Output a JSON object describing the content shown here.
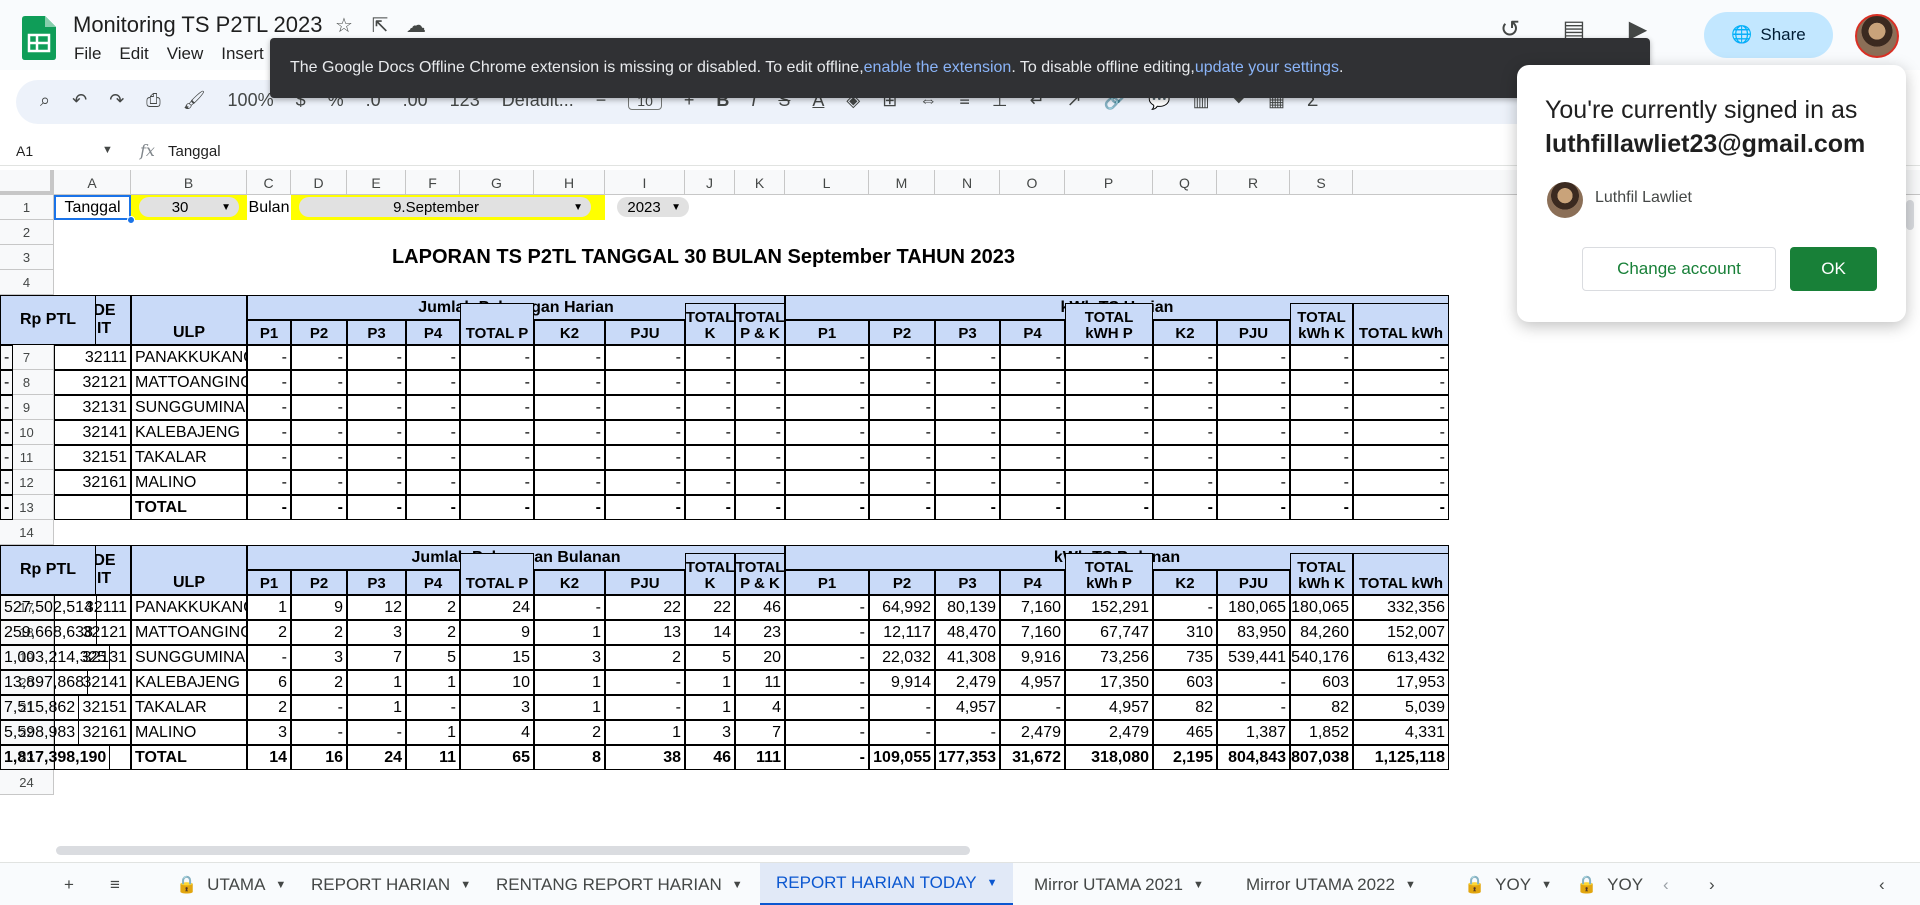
{
  "doc": {
    "title": "Monitoring TS P2TL 2023",
    "menu": [
      "File",
      "Edit",
      "View",
      "Insert"
    ]
  },
  "header": {
    "share_label": "Share"
  },
  "toolbar": {
    "zoom": "100%",
    "font": "Default...",
    "font_size": "10"
  },
  "formula_bar": {
    "cell_ref": "A1",
    "fx": "fx",
    "value": "Tanggal"
  },
  "grid": {
    "columns": [
      "A",
      "B",
      "C",
      "D",
      "E",
      "F",
      "G",
      "H",
      "I",
      "J",
      "K",
      "L",
      "M",
      "N",
      "O",
      "P",
      "Q",
      "R",
      "S"
    ],
    "rows": [
      "1",
      "2",
      "3",
      "4",
      "5",
      "6",
      "7",
      "8",
      "9",
      "10",
      "11",
      "12",
      "13",
      "14",
      "15",
      "16",
      "17",
      "18",
      "19",
      "20",
      "21",
      "22",
      "23",
      "24"
    ],
    "row1": {
      "tanggal_label": "Tanggal",
      "tanggal_value": "30",
      "bulan_label": "Bulan",
      "bulan_value": "9.September",
      "tahun_value": "2023"
    },
    "report_title": "LAPORAN TS P2TL TANGGAL 30 BULAN September TAHUN 2023"
  },
  "table_daily": {
    "group1": "Jumlah Pelanggan Harian",
    "group2": "kWh TS Harian",
    "rp_header": "Rp PTL",
    "kode_header": "KODE UNIT",
    "ulp_header": "ULP",
    "sub_headers": [
      "P1",
      "P2",
      "P3",
      "P4",
      "TOTAL P",
      "K2",
      "PJU",
      "TOTAL K",
      "TOTAL P & K",
      "P1",
      "P2",
      "P3",
      "P4",
      "TOTAL kWH P",
      "K2",
      "PJU",
      "TOTAL kWh K",
      "TOTAL kWh"
    ],
    "rows": [
      {
        "kode": "32111",
        "ulp": "PANAKKUKANG",
        "vals": [
          "-",
          "-",
          "-",
          "-",
          "-",
          "-",
          "-",
          "-",
          "-",
          "-",
          "-",
          "-",
          "-",
          "-",
          "-",
          "-",
          "-",
          "-",
          "-"
        ]
      },
      {
        "kode": "32121",
        "ulp": "MATTOANGING",
        "vals": [
          "-",
          "-",
          "-",
          "-",
          "-",
          "-",
          "-",
          "-",
          "-",
          "-",
          "-",
          "-",
          "-",
          "-",
          "-",
          "-",
          "-",
          "-",
          "-"
        ]
      },
      {
        "kode": "32131",
        "ulp": "SUNGGUMINASA",
        "vals": [
          "-",
          "-",
          "-",
          "-",
          "-",
          "-",
          "-",
          "-",
          "-",
          "-",
          "-",
          "-",
          "-",
          "-",
          "-",
          "-",
          "-",
          "-",
          "-"
        ]
      },
      {
        "kode": "32141",
        "ulp": "KALEBAJENG",
        "vals": [
          "-",
          "-",
          "-",
          "-",
          "-",
          "-",
          "-",
          "-",
          "-",
          "-",
          "-",
          "-",
          "-",
          "-",
          "-",
          "-",
          "-",
          "-",
          "-"
        ]
      },
      {
        "kode": "32151",
        "ulp": "TAKALAR",
        "vals": [
          "-",
          "-",
          "-",
          "-",
          "-",
          "-",
          "-",
          "-",
          "-",
          "-",
          "-",
          "-",
          "-",
          "-",
          "-",
          "-",
          "-",
          "-",
          "-"
        ]
      },
      {
        "kode": "32161",
        "ulp": "MALINO",
        "vals": [
          "-",
          "-",
          "-",
          "-",
          "-",
          "-",
          "-",
          "-",
          "-",
          "-",
          "-",
          "-",
          "-",
          "-",
          "-",
          "-",
          "-",
          "-",
          "-"
        ]
      }
    ],
    "total": {
      "label": "TOTAL",
      "vals": [
        "-",
        "-",
        "-",
        "-",
        "-",
        "-",
        "-",
        "-",
        "-",
        "-",
        "-",
        "-",
        "-",
        "-",
        "-",
        "-",
        "-",
        "-",
        "-"
      ]
    }
  },
  "table_monthly": {
    "group1": "Jumlah Pelanggan Bulanan",
    "group2": "kWh TS Bulanan",
    "rp_header": "Rp PTL",
    "kode_header": "KODE UNIT",
    "ulp_header": "ULP",
    "sub_headers": [
      "P1",
      "P2",
      "P3",
      "P4",
      "TOTAL P",
      "K2",
      "PJU",
      "TOTAL K",
      "TOTAL P & K",
      "P1",
      "P2",
      "P3",
      "P4",
      "TOTAL kWh P",
      "K2",
      "PJU",
      "TOTAL kWh K",
      "TOTAL kWh"
    ],
    "rows": [
      {
        "kode": "32111",
        "ulp": "PANAKKUKANG",
        "vals": [
          "1",
          "9",
          "12",
          "2",
          "24",
          "-",
          "22",
          "22",
          "46",
          "-",
          "64,992",
          "80,139",
          "7,160",
          "152,291",
          "-",
          "180,065",
          "180,065",
          "332,356",
          "527,502,514"
        ]
      },
      {
        "kode": "32121",
        "ulp": "MATTOANGING",
        "vals": [
          "2",
          "2",
          "3",
          "2",
          "9",
          "1",
          "13",
          "14",
          "23",
          "-",
          "12,117",
          "48,470",
          "7,160",
          "67,747",
          "310",
          "83,950",
          "84,260",
          "152,007",
          "259,668,638"
        ]
      },
      {
        "kode": "32131",
        "ulp": "SUNGGUMINASA",
        "vals": [
          "-",
          "3",
          "7",
          "5",
          "15",
          "3",
          "2",
          "5",
          "20",
          "-",
          "22,032",
          "41,308",
          "9,916",
          "73,256",
          "735",
          "539,441",
          "540,176",
          "613,432",
          "1,003,214,325"
        ]
      },
      {
        "kode": "32141",
        "ulp": "KALEBAJENG",
        "vals": [
          "6",
          "2",
          "1",
          "1",
          "10",
          "1",
          "-",
          "1",
          "11",
          "-",
          "9,914",
          "2,479",
          "4,957",
          "17,350",
          "603",
          "-",
          "603",
          "17,953",
          "13,897,868"
        ]
      },
      {
        "kode": "32151",
        "ulp": "TAKALAR",
        "vals": [
          "2",
          "-",
          "1",
          "-",
          "3",
          "1",
          "-",
          "1",
          "4",
          "-",
          "-",
          "4,957",
          "-",
          "4,957",
          "82",
          "-",
          "82",
          "5,039",
          "7,515,862"
        ]
      },
      {
        "kode": "32161",
        "ulp": "MALINO",
        "vals": [
          "3",
          "-",
          "-",
          "1",
          "4",
          "2",
          "1",
          "3",
          "7",
          "-",
          "-",
          "-",
          "2,479",
          "2,479",
          "465",
          "1,387",
          "1,852",
          "4,331",
          "5,598,983"
        ]
      }
    ],
    "total": {
      "label": "TOTAL",
      "vals": [
        "14",
        "16",
        "24",
        "11",
        "65",
        "8",
        "38",
        "46",
        "111",
        "-",
        "109,055",
        "177,353",
        "31,672",
        "318,080",
        "2,195",
        "804,843",
        "807,038",
        "1,125,118",
        "1,817,398,190"
      ]
    }
  },
  "tabs": [
    {
      "label": "UTAMA",
      "locked": true
    },
    {
      "label": "REPORT HARIAN",
      "locked": false
    },
    {
      "label": "RENTANG REPORT HARIAN",
      "locked": false
    },
    {
      "label": "REPORT HARIAN TODAY",
      "locked": false,
      "active": true
    },
    {
      "label": "Mirror UTAMA 2021",
      "locked": false
    },
    {
      "label": "Mirror UTAMA 2022",
      "locked": false
    },
    {
      "label": "YOY",
      "locked": true
    },
    {
      "label": "YOY L",
      "locked": true
    }
  ],
  "banner": {
    "text1": "The Google Docs Offline Chrome extension is missing or disabled. To edit offline, ",
    "link1": "enable the extension",
    "text2": ". To disable offline editing, ",
    "link2": "update your settings",
    "text3": "."
  },
  "account_popup": {
    "title": "You're currently signed in as",
    "email": "luthfillawliet23@gmail.com",
    "name": "Luthfil Lawliet",
    "change_label": "Change account",
    "ok_label": "OK"
  },
  "colors": {
    "header_blue": "#c9daf8",
    "yellow": "#ffff00",
    "share_bg": "#c2e7ff",
    "ok_green": "#188038",
    "active_tab": "#0b57d0"
  }
}
